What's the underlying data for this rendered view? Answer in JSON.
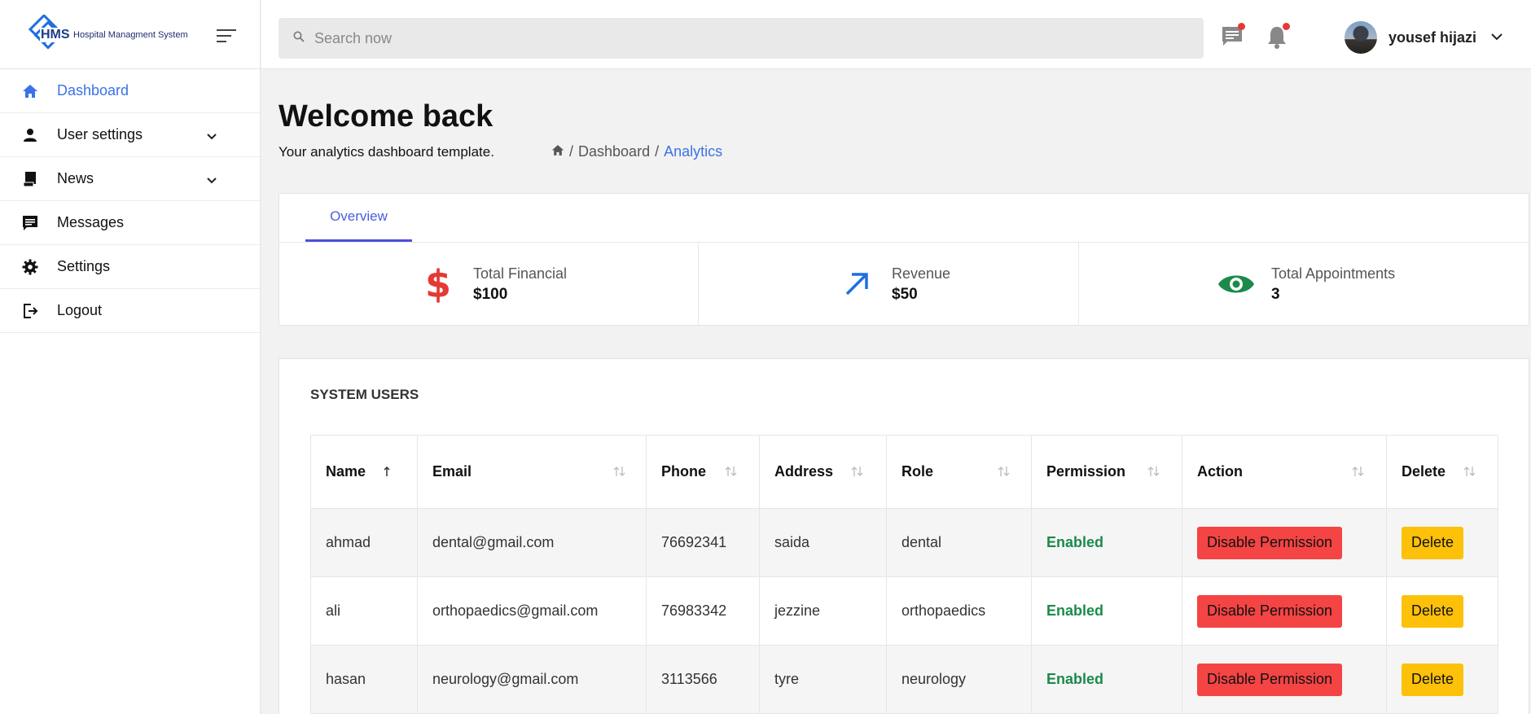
{
  "brand": {
    "logo_text": "HMS",
    "name": "Hospital Managment System"
  },
  "sidebar": {
    "items": [
      {
        "label": "Dashboard",
        "icon": "home-icon"
      },
      {
        "label": "User settings",
        "icon": "person-icon"
      },
      {
        "label": "News",
        "icon": "news-icon"
      },
      {
        "label": "Messages",
        "icon": "message-icon"
      },
      {
        "label": "Settings",
        "icon": "gear-icon"
      },
      {
        "label": "Logout",
        "icon": "logout-icon"
      }
    ]
  },
  "topbar": {
    "search_placeholder": "Search now",
    "user_name": "yousef hijazi"
  },
  "header": {
    "title": "Welcome back",
    "subtitle": "Your analytics dashboard template.",
    "breadcrumb": {
      "sep": "/",
      "level1": "Dashboard",
      "current": "Analytics"
    }
  },
  "overview": {
    "tab": "Overview",
    "stats": [
      {
        "label": "Total Financial",
        "value": "$100",
        "icon": "dollar-icon",
        "color": "#e53935"
      },
      {
        "label": "Revenue",
        "value": "$50",
        "icon": "arrow-up-right-icon",
        "color": "#1e6fe0"
      },
      {
        "label": "Total Appointments",
        "value": "3",
        "icon": "eye-icon",
        "color": "#1b8a4a"
      }
    ]
  },
  "users": {
    "title": "SYSTEM USERS",
    "columns": [
      "Name",
      "Email",
      "Phone",
      "Address",
      "Role",
      "Permission",
      "Action",
      "Delete"
    ],
    "rows": [
      {
        "name": "ahmad",
        "email": "dental@gmail.com",
        "phone": "76692341",
        "address": "saida",
        "role": "dental",
        "permission": "Enabled",
        "action": "Disable Permission",
        "delete": "Delete"
      },
      {
        "name": "ali",
        "email": "orthopaedics@gmail.com",
        "phone": "76983342",
        "address": "jezzine",
        "role": "orthopaedics",
        "permission": "Enabled",
        "action": "Disable Permission",
        "delete": "Delete"
      },
      {
        "name": "hasan",
        "email": "neurology@gmail.com",
        "phone": "3113566",
        "address": "tyre",
        "role": "neurology",
        "permission": "Enabled",
        "action": "Disable Permission",
        "delete": "Delete"
      }
    ]
  },
  "colors": {
    "accent": "#3b72e8",
    "danger": "#f44444",
    "warning": "#fcc108",
    "success": "#1b8a4a"
  }
}
